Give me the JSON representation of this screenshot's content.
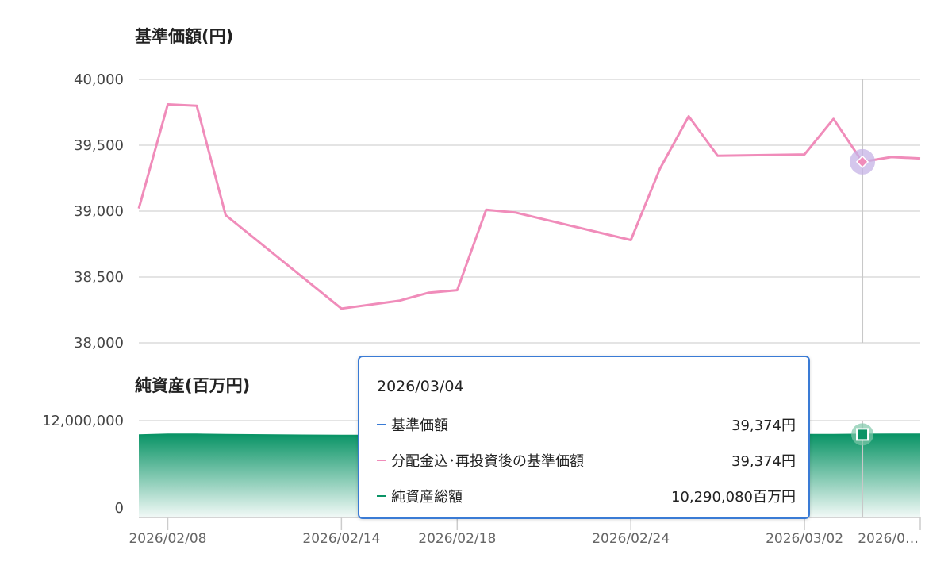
{
  "chart_data": [
    {
      "type": "line",
      "title": "基準価額(円)",
      "ylim": [
        38000,
        40000
      ],
      "yticks": [
        "40,000",
        "39,500",
        "39,000",
        "38,500",
        "38,000"
      ],
      "grid": true,
      "series": [
        {
          "name": "分配金込・再投資後の基準価額",
          "color": "#f08cba",
          "values": [
            39020,
            39810,
            39800,
            38970,
            38260,
            38320,
            38380,
            38400,
            39010,
            38990,
            38780,
            39320,
            39720,
            39420,
            39430,
            39700,
            39374,
            39410,
            39400
          ]
        }
      ]
    },
    {
      "type": "area",
      "title": "純資産(百万円)",
      "ylim": [
        0,
        12000000
      ],
      "yticks": [
        "12,000,000",
        "0"
      ],
      "series": [
        {
          "name": "純資産総額",
          "color": "#0a9466",
          "values": [
            10200000,
            10300000,
            10300000,
            10250000,
            10150000,
            10160000,
            10180000,
            10170000,
            10200000,
            10210000,
            10220000,
            10230000,
            10260000,
            10270000,
            10260000,
            10250000,
            10290080,
            10300000,
            10300000
          ]
        }
      ]
    }
  ],
  "x_axis": {
    "dates": [
      "2026/02/07",
      "2026/02/08",
      "2026/02/09",
      "2026/02/10",
      "2026/02/14",
      "2026/02/16",
      "2026/02/17",
      "2026/02/18",
      "2026/02/19",
      "2026/02/20",
      "2026/02/24",
      "2026/02/25",
      "2026/02/26",
      "2026/02/27",
      "2026/03/02",
      "2026/03/03",
      "2026/03/04",
      "2026/03/05",
      "2026/03/06"
    ],
    "tick_labels": [
      "2026/02/08",
      "2026/02/14",
      "2026/02/18",
      "2026/02/24",
      "2026/03/02",
      "2026/0…"
    ]
  },
  "tooltip": {
    "date": "2026/03/04",
    "rows": [
      {
        "label": "基準価額",
        "value": "39,374円",
        "color": "#3a7bd5"
      },
      {
        "label": "分配金込･再投資後の基準価額",
        "value": "39,374円",
        "color": "#f08cba"
      },
      {
        "label": "純資産総額",
        "value": "10,290,080百万円",
        "color": "#0a9466"
      }
    ]
  },
  "highlight_index": 16
}
